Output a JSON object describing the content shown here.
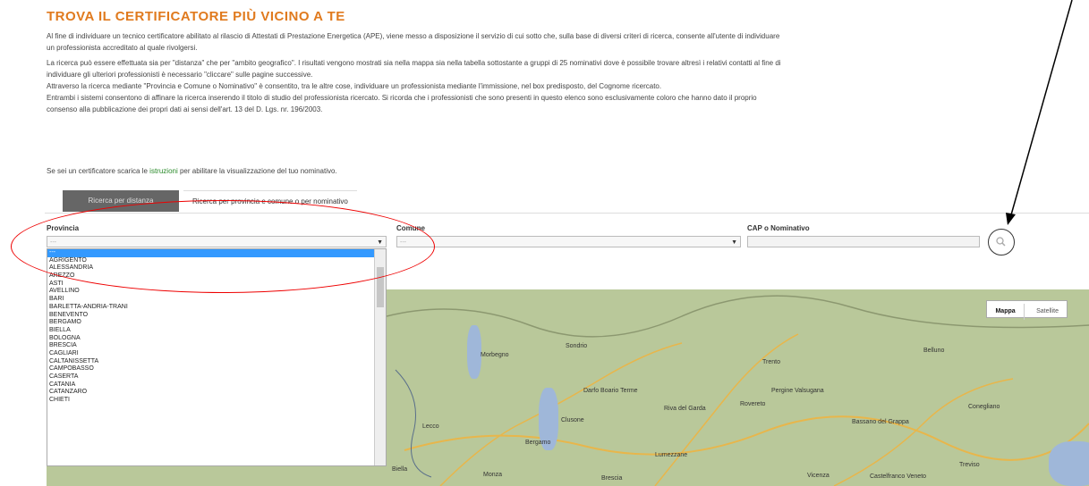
{
  "page": {
    "title": "TROVA IL CERTIFICATORE PIÙ VICINO A TE",
    "intro_line1": "Al fine di individuare un tecnico certificatore abilitato al rilascio di Attestati di Prestazione Energetica (APE), viene messo a disposizione il servizio di cui sotto che, sulla base di diversi criteri di ricerca, consente all'utente di individuare",
    "intro_line2": "un professionista accreditato al quale rivolgersi.",
    "search_line1": "La ricerca può essere effettuata sia per \"distanza\" che per \"ambito geografico\". I risultati vengono mostrati sia nella mappa sia nella tabella sottostante a gruppi di 25 nominativi dove è possibile trovare altresì i relativi contatti al fine di",
    "search_line2": "individuare gli ulteriori professionisti è necessario \"cliccare\" sulle pagine successive.",
    "search_line3": "Attraverso la ricerca mediante \"Provincia e Comune o Nominativo\" è consentito, tra le altre cose, individuare un professionista mediante l'immissione, nel box predisposto, del Cognome ricercato.",
    "search_line4": "Entrambi i sistemi consentono di affinare la ricerca inserendo il titolo di studio del professionista ricercato. Si ricorda che i professionisti che sono presenti in questo elenco sono esclusivamente coloro che hanno dato il proprio",
    "search_line5": "consenso alla pubblicazione dei propri dati ai sensi dell'art. 13 del D. Lgs. nr. 196/2003.",
    "cert_prefix": "Se sei un certificatore scarica le",
    "cert_link": "istruzioni",
    "cert_suffix": "per abilitare la visualizzazione del tuo nominativo."
  },
  "tabs": {
    "distance": "Ricerca per distanza",
    "province": "Ricerca per provincia e comune o per nominativo"
  },
  "form": {
    "provincia_label": "Provincia",
    "comune_label": "Comune",
    "cap_label": "CAP o Nominativo",
    "provincia_value": "---",
    "comune_value": "---",
    "search_icon": "search-icon"
  },
  "dropdown": {
    "options": [
      "---",
      "AGRIGENTO",
      "ALESSANDRIA",
      "AREZZO",
      "ASTI",
      "AVELLINO",
      "BARI",
      "BARLETTA-ANDRIA-TRANI",
      "BENEVENTO",
      "BERGAMO",
      "BIELLA",
      "BOLOGNA",
      "BRESCIA",
      "CAGLIARI",
      "CALTANISSETTA",
      "CAMPOBASSO",
      "CASERTA",
      "CATANIA",
      "CATANZARO",
      "CHIETI"
    ],
    "selected_index": 0
  },
  "map": {
    "btn_map": "Mappa",
    "btn_sat": "Satellite",
    "cities": [
      "Trento",
      "Bergamo",
      "Brescia",
      "Monza",
      "Lecco",
      "Sondrio",
      "Vicenza",
      "Bassano del Grappa",
      "Belluno",
      "Treviso",
      "Pergine Valsugana",
      "Castelfranco Veneto",
      "Morbegno",
      "Biella",
      "Darfo Boario Terme",
      "Lumezzane",
      "Clusone",
      "Riva del Garda",
      "Rovereto",
      "Conegliano"
    ]
  },
  "colors": {
    "title": "#e07a1e",
    "tab_active_bg": "#666666",
    "dropdown_selected": "#3399ff",
    "annotation": "#ee0000"
  }
}
